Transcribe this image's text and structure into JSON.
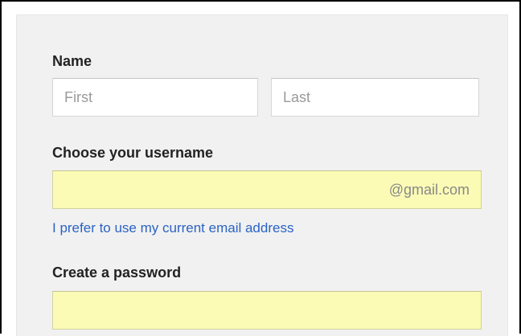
{
  "name_section": {
    "label": "Name",
    "first_placeholder": "First",
    "last_placeholder": "Last"
  },
  "username_section": {
    "label": "Choose your username",
    "value": "",
    "suffix": "@gmail.com",
    "alt_link": "I prefer to use my current email address"
  },
  "password_section": {
    "label": "Create a password",
    "value": ""
  },
  "colors": {
    "panel_bg": "#f1f1f1",
    "highlight_field_bg": "#fbfbb6",
    "link": "#2a63c4"
  }
}
